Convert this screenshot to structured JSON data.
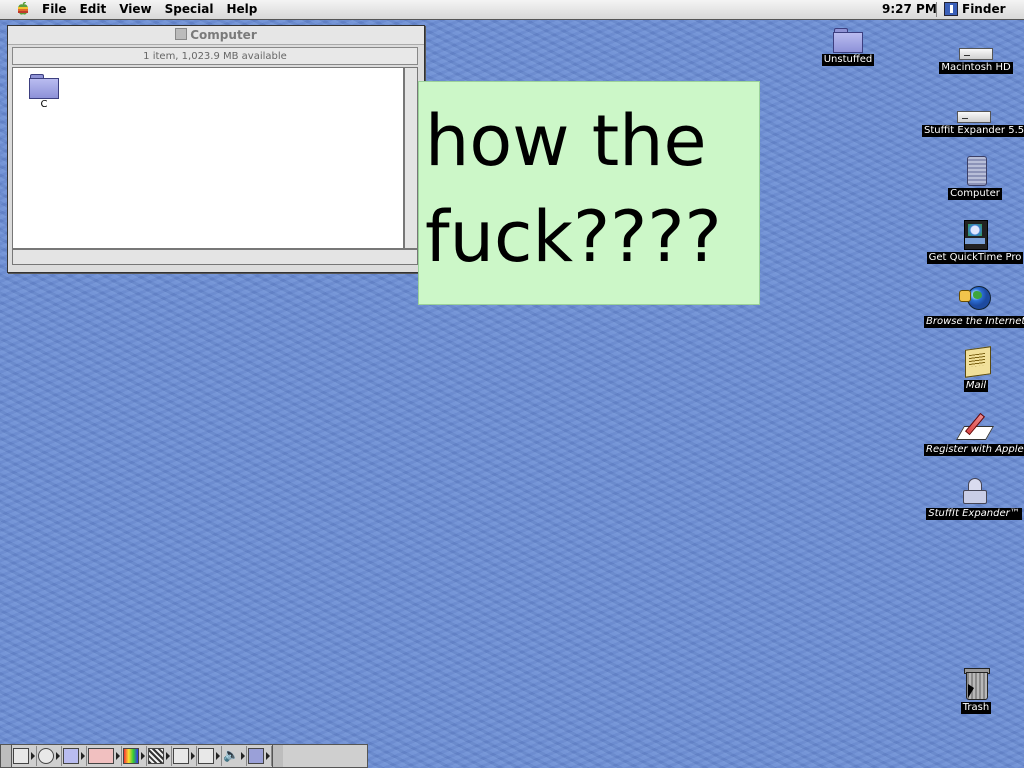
{
  "menubar": {
    "menus": [
      "File",
      "Edit",
      "View",
      "Special",
      "Help"
    ],
    "clock": "9:27 PM",
    "app": "Finder"
  },
  "finder_window": {
    "title": "Computer",
    "info": "1 item, 1,023.9 MB available",
    "items": [
      {
        "label": "C",
        "icon": "folder-icon"
      }
    ]
  },
  "sticky": {
    "line1": "how the",
    "line2": "fuck????"
  },
  "desktop": {
    "icons": [
      {
        "label": "Unstuffed",
        "icon": "folder-icon"
      },
      {
        "label": "Macintosh HD",
        "icon": "hard-disk-icon"
      },
      {
        "label": "Stuffit Expander 5.5",
        "icon": "disk-image-icon"
      },
      {
        "label": "Computer",
        "icon": "computer-icon"
      },
      {
        "label": "Get QuickTime Pro",
        "icon": "quicktime-movie-icon"
      },
      {
        "label": "Browse the Internet",
        "icon": "globe-alias-icon"
      },
      {
        "label": "Mail",
        "icon": "mail-alias-icon"
      },
      {
        "label": "Register with Apple",
        "icon": "register-alias-icon"
      },
      {
        "label": "StuffIt Expander™",
        "icon": "stuffit-alias-icon"
      },
      {
        "label": "Trash",
        "icon": "trash-icon"
      }
    ]
  },
  "control_strip": {
    "modules": [
      "monitor",
      "cd-player",
      "file-sharing",
      "appletalk",
      "color-depth",
      "resolution",
      "printer",
      "remote-access",
      "sound-volume",
      "keychain"
    ]
  }
}
